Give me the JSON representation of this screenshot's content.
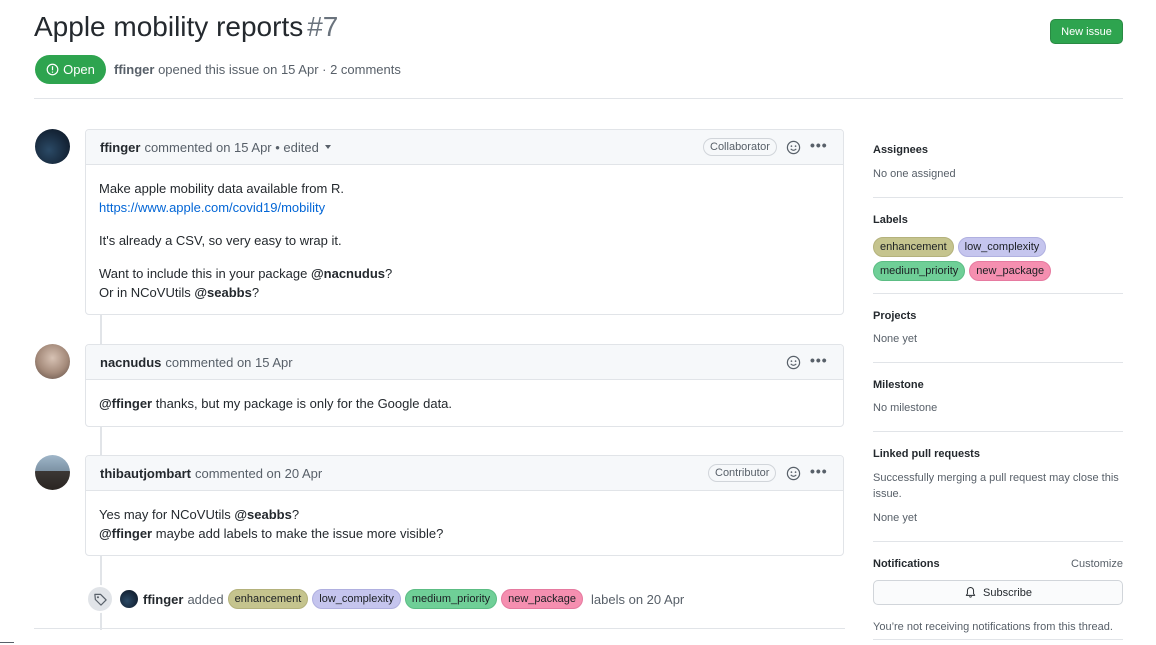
{
  "issue": {
    "title": "Apple mobility reports",
    "number": "#7",
    "state": "Open",
    "author": "ffinger",
    "meta": "opened this issue on 15 Apr · 2 comments",
    "new_issue_label": "New issue"
  },
  "comments": [
    {
      "author": "ffinger",
      "when": "commented on 15 Apr • edited",
      "role": "Collaborator",
      "body": {
        "line1": "Make apple mobility data available from R.",
        "link": "https://www.apple.com/covid19/mobility",
        "line2": "It's already a CSV, so very easy to wrap it.",
        "line3_pre": "Want to include this in your package ",
        "line3_mention": "@nacnudus",
        "line3_post": "?",
        "line4_pre": "Or in NCoVUtils ",
        "line4_mention": "@seabbs",
        "line4_post": "?"
      }
    },
    {
      "author": "nacnudus",
      "when": "commented on 15 Apr",
      "body": {
        "mention": "@ffinger",
        "text": " thanks, but my package is only for the Google data."
      }
    },
    {
      "author": "thibautjombart",
      "when": "commented on 20 Apr",
      "role": "Contributor",
      "body": {
        "line1_pre": "Yes may for NCoVUtils ",
        "line1_mention": "@seabbs",
        "line1_post": "?",
        "line2_mention": "@ffinger",
        "line2_text": " maybe add labels to make the issue more visible?"
      }
    }
  ],
  "label_event": {
    "actor": "ffinger",
    "verb": "added",
    "labels": [
      "enhancement",
      "low_complexity",
      "medium_priority",
      "new_package"
    ],
    "suffix": "labels on 20 Apr"
  },
  "sidebar": {
    "assignees": {
      "heading": "Assignees",
      "value": "No one assigned"
    },
    "labels": {
      "heading": "Labels",
      "items": [
        "enhancement",
        "low_complexity",
        "medium_priority",
        "new_package"
      ]
    },
    "projects": {
      "heading": "Projects",
      "value": "None yet"
    },
    "milestone": {
      "heading": "Milestone",
      "value": "No milestone"
    },
    "linked_prs": {
      "heading": "Linked pull requests",
      "description": "Successfully merging a pull request may close this issue.",
      "value": "None yet"
    },
    "notifications": {
      "heading": "Notifications",
      "customize": "Customize",
      "subscribe": "Subscribe",
      "note": "You’re not receiving notifications from this thread."
    }
  },
  "colors": {
    "open_green": "#2ea44f",
    "link_blue": "#0366d6",
    "label_enhancement": "#c5c48e",
    "label_low_complexity": "#c5c5ee",
    "label_medium_priority": "#6fcf97",
    "label_new_package": "#f58fb0"
  }
}
